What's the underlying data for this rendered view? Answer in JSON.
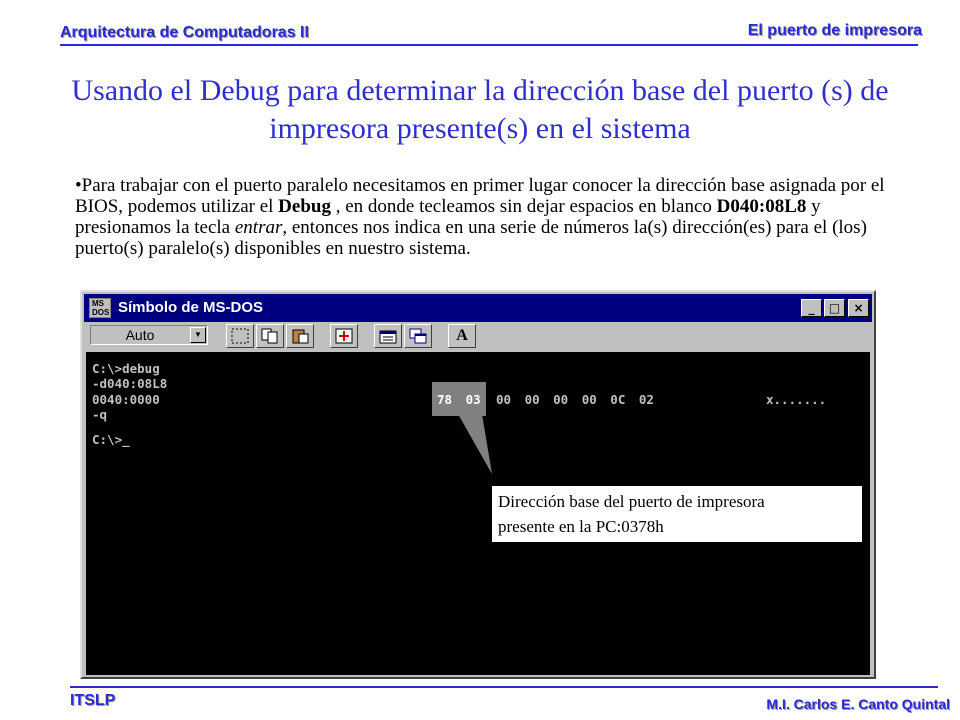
{
  "header": {
    "course": "Arquitectura de Computadoras II",
    "topic": "El puerto de impresora"
  },
  "slide": {
    "title": "Usando el Debug para determinar la dirección base del puerto (s) de impresora presente(s) en el sistema",
    "bullet": {
      "part1": "Para trabajar con el puerto paralelo necesitamos en primer lugar conocer la dirección base asignada por el BIOS, podemos utilizar el ",
      "bold1": "Debug",
      "part2": " , en donde tecleamos sin dejar espacios en blanco ",
      "bold2": "D040:08L8",
      "part3": " y presionamos la tecla ",
      "italic1": "entrar",
      "part4": ", entonces  nos indica en una serie de números la(s) dirección(es) para el (los) puerto(s) paralelo(s) disponibles en nuestro sistema."
    }
  },
  "window": {
    "title": "Símbolo de MS-DOS",
    "icon_label": "MS DOS",
    "controls": {
      "minimize": "_",
      "maximize": "□",
      "close": "×"
    },
    "toolbar": {
      "font_select": "Auto",
      "buttons": [
        "mark-icon",
        "copy-icon",
        "paste-icon",
        "fullscreen-icon",
        "properties-icon",
        "background-icon",
        "font-icon"
      ],
      "font_button_label": "A"
    }
  },
  "console": {
    "lines": [
      "C:\\>debug",
      "-d040:08L8",
      "0040:0000",
      "-q",
      "",
      "C:\\>_"
    ],
    "highlighted_bytes": "78 03",
    "remaining_bytes": "00 00 00 00 0C 02",
    "ascii": "x......."
  },
  "callout": {
    "line1": "Dirección base del puerto de impresora",
    "line2": "presente en la PC:0378h"
  },
  "footer": {
    "institution": "ITSLP",
    "author": "M.I.  Carlos E. Canto Quintal"
  },
  "colors": {
    "accent": "#2a2ad6",
    "title_blue": "#2f2fd0",
    "titlebar": "#000080",
    "window_face": "#c0c0c0",
    "console_bg": "#000000",
    "console_text": "#c0c0c0"
  }
}
